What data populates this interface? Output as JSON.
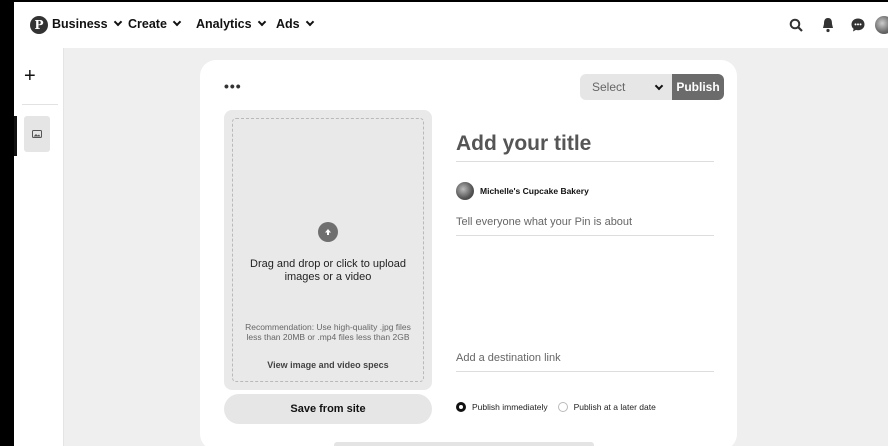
{
  "nav": {
    "items": [
      {
        "label": "Business"
      },
      {
        "label": "Create"
      },
      {
        "label": "Analytics"
      },
      {
        "label": "Ads"
      }
    ],
    "icons": [
      "search-icon",
      "bell-icon",
      "messages-icon",
      "account-avatar"
    ]
  },
  "rail": {
    "add_label": "+"
  },
  "editor": {
    "more_label": "•••",
    "board_select": "Select",
    "publish_label": "Publish",
    "upload": {
      "drag_text": "Drag and drop or click to upload images or a video",
      "recommendation": "Recommendation: Use high-quality .jpg files less than 20MB or .mp4 files less than 2GB",
      "specs_link": "View image and video specs"
    },
    "save_from_site": "Save from site",
    "title_placeholder": "Add your title",
    "author_name": "Michelle's Cupcake Bakery",
    "about_placeholder": "Tell everyone what your Pin is about",
    "link_placeholder": "Add a destination link",
    "publish_options": [
      {
        "label": "Publish immediately",
        "selected": true
      },
      {
        "label": "Publish at a later date",
        "selected": false
      }
    ]
  },
  "colors": {
    "page_bg": "#efefef",
    "card_bg": "#ffffff",
    "publish_bg": "#6b6b6b"
  }
}
